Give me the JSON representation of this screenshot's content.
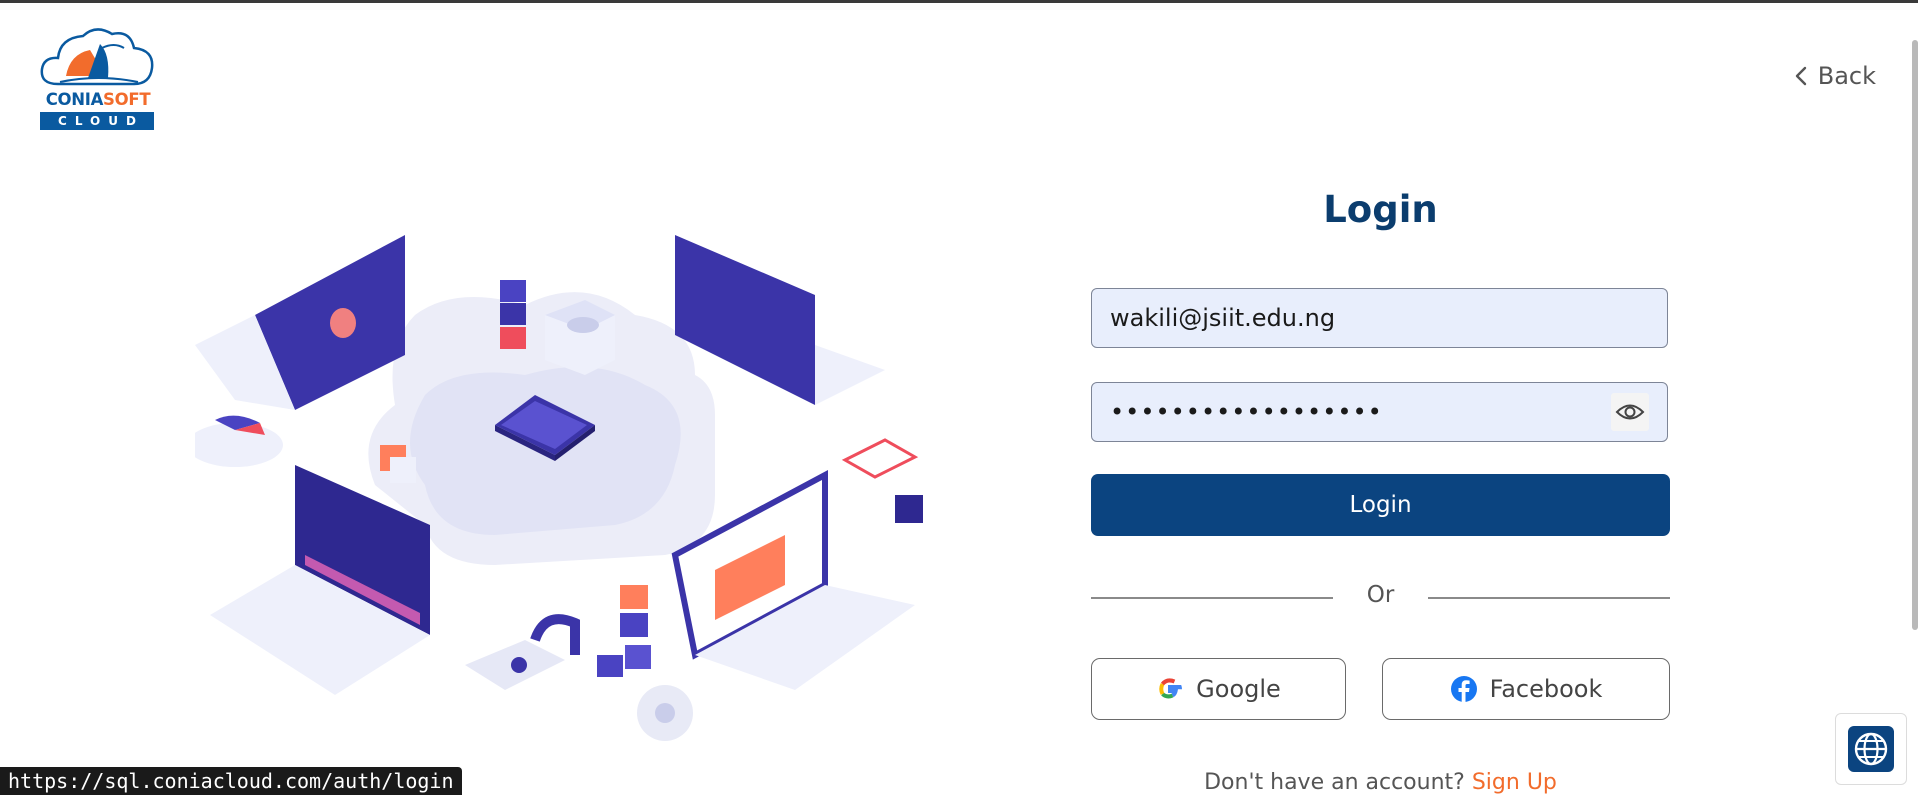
{
  "logo": {
    "word_part1": "CONIA",
    "word_part2": "SOFT",
    "band": "CLOUD"
  },
  "nav": {
    "back_label": "Back"
  },
  "form": {
    "title": "Login",
    "email_value": "wakili@jsiit.edu.ng",
    "password_masked": "••••••••••••••••••",
    "login_button": "Login",
    "or_label": "Or",
    "google_label": "Google",
    "facebook_label": "Facebook",
    "signup_prompt": "Don't have an account?",
    "signup_link": "Sign Up"
  },
  "status_bar": {
    "url": "https://sql.coniacloud.com/auth/login"
  },
  "colors": {
    "primary": "#0b4480",
    "accent": "#f26c2c",
    "field_bg": "#e8eefc",
    "title": "#0b3d6e"
  },
  "icons": {
    "back": "chevron-left-icon",
    "eye": "eye-icon",
    "google": "google-icon",
    "facebook": "facebook-icon",
    "globe": "globe-icon"
  }
}
